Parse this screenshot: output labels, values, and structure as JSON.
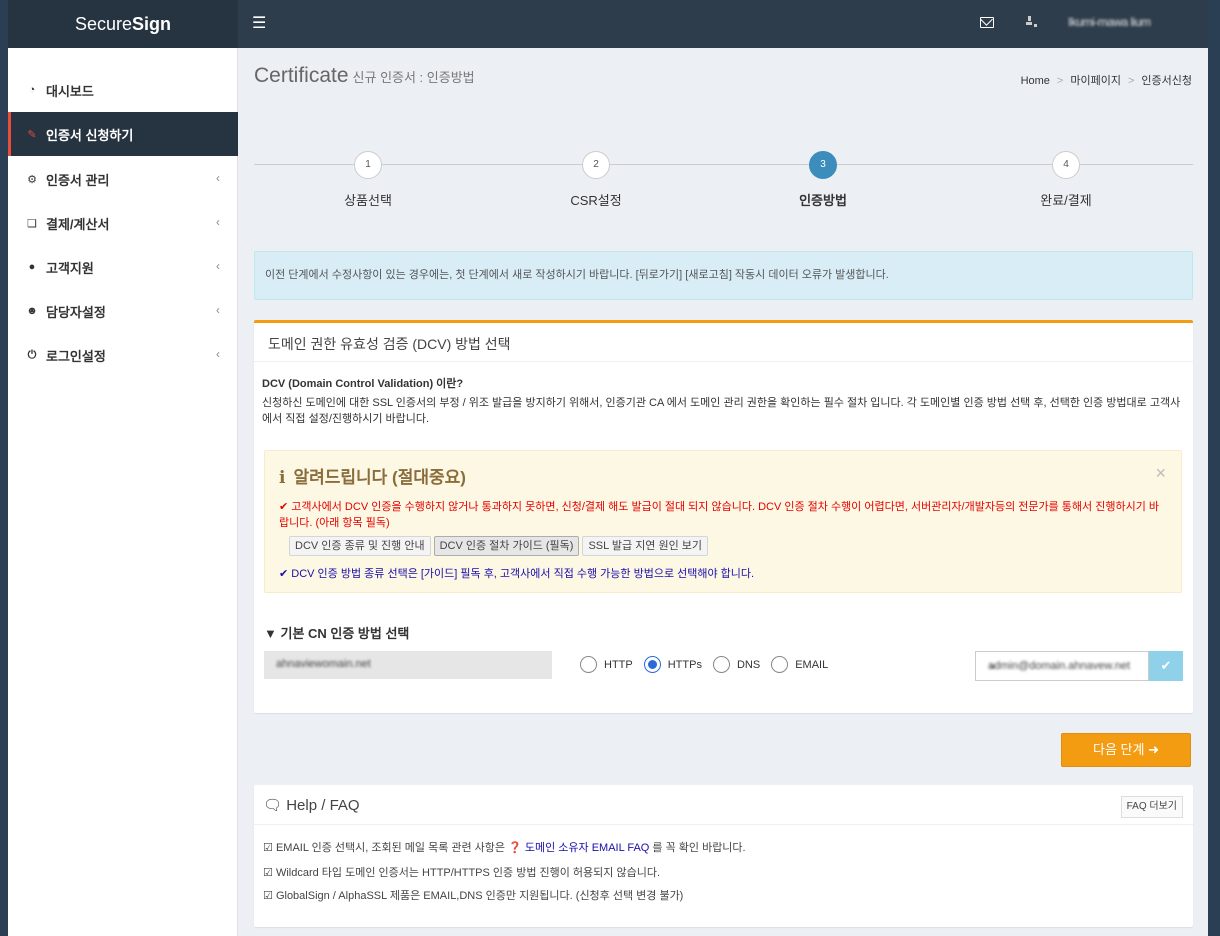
{
  "header": {
    "logo_prefix": "Secure",
    "logo_bold": "Sign",
    "menu_icon": "hamburger-icon",
    "username": "Ikumi-mawa lium"
  },
  "sidebar": {
    "items": [
      {
        "label": "대시보드",
        "icon": "dashboard-icon"
      },
      {
        "label": "인증서 신청하기",
        "icon": "edit-icon"
      },
      {
        "label": "인증서 관리",
        "icon": "gears-icon"
      },
      {
        "label": "결제/계산서",
        "icon": "copy-icon"
      },
      {
        "label": "고객지원",
        "icon": "comments-icon"
      },
      {
        "label": "담당자설정",
        "icon": "users-icon"
      },
      {
        "label": "로그인설정",
        "icon": "power-icon"
      }
    ]
  },
  "page": {
    "title": "Certificate",
    "subtitle": "신규 인증서 : 인증방법",
    "breadcrumb": [
      "Home",
      "마이페이지",
      "인증서신청"
    ]
  },
  "stepper": {
    "current": 3,
    "steps": [
      {
        "num": "1",
        "label": "상품선택"
      },
      {
        "num": "2",
        "label": "CSR설정"
      },
      {
        "num": "3",
        "label": "인증방법"
      },
      {
        "num": "4",
        "label": "완료/결제"
      }
    ]
  },
  "info_alert": "이전 단계에서 수정사항이 있는 경우에는, 첫 단계에서 새로 작성하시기 바랍니다. [뒤로가기] [새로고침] 작동시 데이터 오류가 발생합니다.",
  "dcv": {
    "box_title": "도메인 권한 유효성 검증 (DCV) 방법 선택",
    "question": "DCV (Domain Control Validation) 이란?",
    "description": "신청하신 도메인에 대한 SSL 인증서의 부정 / 위조 발급을 방지하기 위해서, 인증기관 CA 에서 도메인 관리 권한을 확인하는 필수 절차 입니다. 각 도메인별 인증 방법 선택 후, 선택한 인증 방법대로 고객사에서 직접 설정/진행하시기 바랍니다.",
    "warning": {
      "icon": "info-icon",
      "title": "알려드립니다 (절대중요)",
      "red_text": "✔ 고객사에서 DCV 인증을 수행하지 않거나 통과하지 못하면, 신청/결제 해도 발급이 절대 되지 않습니다. DCV 인증 절차 수행이 어렵다면, 서버관리자/개발자등의 전문가를 통해서 진행하시기 바랍니다. (아래 항목 필독)",
      "buttons": [
        "DCV 인증 종류 및 진행 안내",
        "DCV 인증 절차 가이드 (필독)",
        "SSL 발급 지연 원인 보기"
      ],
      "blue_text": "DCV 인증 방법 종류 선택은 [가이드] 필독 후, 고객사에서 직접 수행 가능한 방법으로 선택해야 합니다."
    },
    "cn_title": "▼ 기본 CN 인증 방법 선택",
    "domain": "ahnaviewomain.net",
    "methods": [
      "HTTP",
      "HTTPs",
      "DNS",
      "EMAIL"
    ],
    "selected_method": "HTTPs",
    "email_value": "admin@domain.ahnavew.net"
  },
  "next_button": "다음 단계",
  "help": {
    "title": "Help / FAQ",
    "more_button": "FAQ 더보기",
    "line1_prefix": "EMAIL 인증 선택시, 조회된 메일 목록 관련 사항은",
    "line1_link": "도메인 소유자 EMAIL FAQ",
    "line1_suffix": "를 꼭 확인 바랍니다.",
    "line2": "Wildcard 타입 도메인 인증서는 HTTP/HTTPS 인증 방법 진행이 허용되지 않습니다.",
    "line3": "GlobalSign / AlphaSSL 제품은 EMAIL,DNS 인증만 지원됩니다. (신청후 선택 변경 불가)"
  },
  "colors": {
    "sidebar_dark": "#263340",
    "header": "#2e3d4c",
    "accent_orange": "#f39c12",
    "step_active": "#3c8dbc",
    "info_bg": "#d9edf7",
    "warn_bg": "#fcf8e3"
  }
}
